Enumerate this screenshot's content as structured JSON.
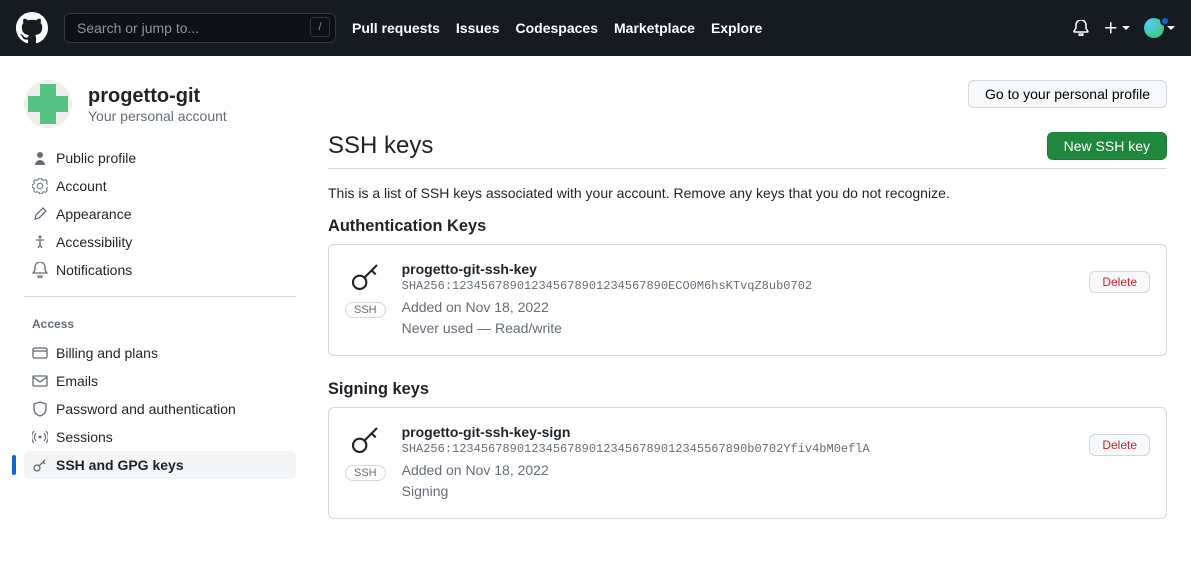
{
  "header": {
    "search_placeholder": "Search or jump to...",
    "slash": "/",
    "nav": [
      "Pull requests",
      "Issues",
      "Codespaces",
      "Marketplace",
      "Explore"
    ]
  },
  "profile": {
    "name": "progetto-git",
    "subtitle": "Your personal account"
  },
  "sidebar": {
    "items1": [
      "Public profile",
      "Account",
      "Appearance",
      "Accessibility",
      "Notifications"
    ],
    "section_access": "Access",
    "items2": [
      "Billing and plans",
      "Emails",
      "Password and authentication",
      "Sessions",
      "SSH and GPG keys"
    ]
  },
  "main": {
    "go_profile": "Go to your personal profile",
    "title": "SSH keys",
    "new_key": "New SSH key",
    "description": "This is a list of SSH keys associated with your account. Remove any keys that you do not recognize.",
    "auth_heading": "Authentication Keys",
    "signing_heading": "Signing keys",
    "delete": "Delete",
    "ssh_badge": "SSH",
    "auth_key": {
      "title": "progetto-git-ssh-key",
      "hash": "SHA256:123456789012345678901234567890ECO0M6hsKTvqZ8ub0702",
      "added": "Added on Nov 18, 2022",
      "used": "Never used — Read/write"
    },
    "sign_key": {
      "title": "progetto-git-ssh-key-sign",
      "hash": "SHA256:12345678901234567890123456789012345567890b0702Yfiv4bM0eflA",
      "added": "Added on Nov 18, 2022",
      "used": "Signing"
    }
  }
}
